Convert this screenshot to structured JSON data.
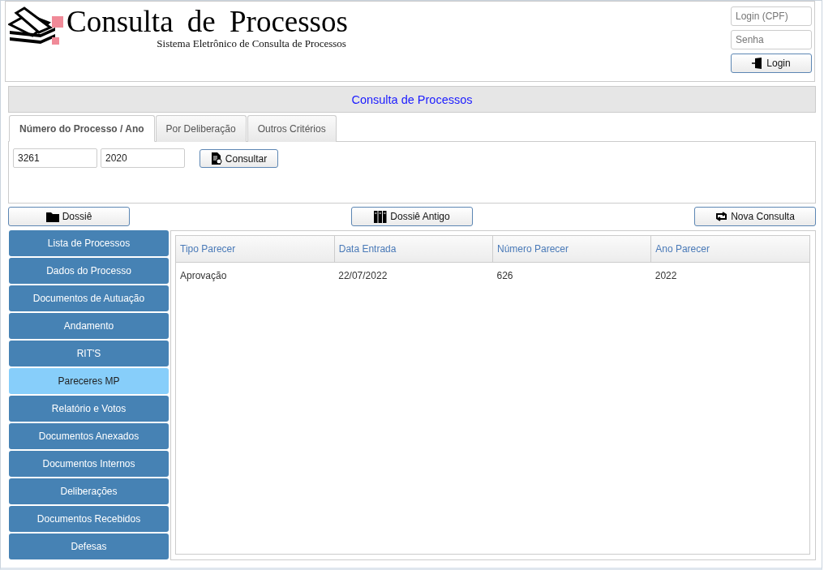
{
  "header": {
    "title": "Consulta de Processos",
    "subtitle": "Sistema Eletrônico de Consulta de Processos"
  },
  "login": {
    "user_placeholder": "Login (CPF)",
    "password_placeholder": "Senha",
    "button": "Login"
  },
  "page_title": "Consulta de Processos",
  "tabs": [
    {
      "label": "Número do Processo / Ano",
      "selected": true
    },
    {
      "label": "Por Deliberação",
      "selected": false
    },
    {
      "label": "Outros Critérios",
      "selected": false
    }
  ],
  "search": {
    "processo": "3261",
    "ano": "2020",
    "button": "Consultar"
  },
  "actions": {
    "dossie": "Dossiê",
    "dossie_antigo": "Dossiê Antigo",
    "nova_consulta": "Nova Consulta"
  },
  "sidebar": {
    "items": [
      {
        "label": "Lista de Processos",
        "selected": false
      },
      {
        "label": "Dados do Processo",
        "selected": false
      },
      {
        "label": "Documentos de Autuação",
        "selected": false
      },
      {
        "label": "Andamento",
        "selected": false
      },
      {
        "label": "RIT'S",
        "selected": false
      },
      {
        "label": "Pareceres MP",
        "selected": true
      },
      {
        "label": "Relatório e Votos",
        "selected": false
      },
      {
        "label": "Documentos Anexados",
        "selected": false
      },
      {
        "label": "Documentos Internos",
        "selected": false
      },
      {
        "label": "Deliberações",
        "selected": false
      },
      {
        "label": "Documentos Recebidos",
        "selected": false
      },
      {
        "label": "Defesas",
        "selected": false
      }
    ]
  },
  "table": {
    "columns": [
      "Tipo Parecer",
      "Data Entrada",
      "Número Parecer",
      "Ano Parecer"
    ],
    "rows": [
      [
        "Aprovação",
        "22/07/2022",
        "626",
        "2022"
      ]
    ]
  }
}
